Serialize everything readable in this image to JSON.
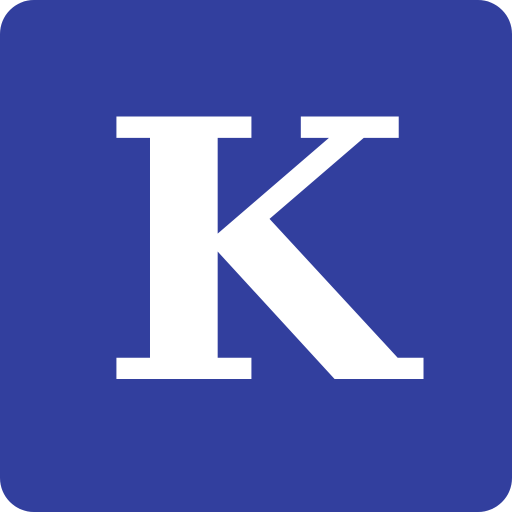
{
  "icon": {
    "letter": "K",
    "background_color": "#323f9e",
    "foreground_color": "#ffffff",
    "icon_name": "k-letter-app-icon"
  }
}
